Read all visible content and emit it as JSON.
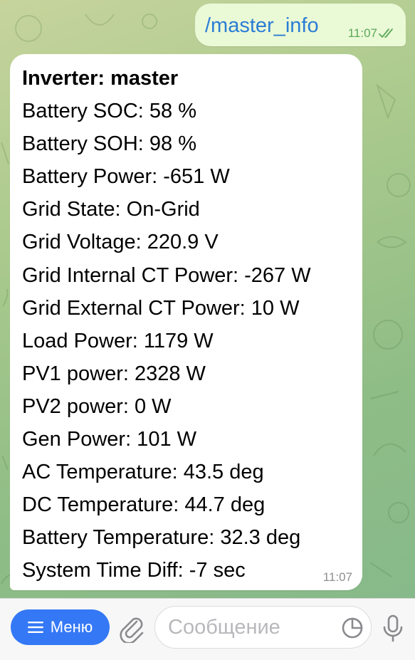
{
  "outgoing_message": {
    "text": "/master_info",
    "time": "11:07",
    "status_icon": "double-check-icon"
  },
  "incoming_message": {
    "lines": [
      "Inverter: master",
      "Battery SOC: 58 %",
      "Battery SOH: 98 %",
      "Battery Power: -651 W",
      "Grid State: On-Grid",
      "Grid Voltage: 220.9 V",
      "Grid Internal CT Power: -267 W",
      "Grid External CT Power: 10 W",
      "Load Power: 1179 W",
      "PV1 power: 2328 W",
      "PV2 power: 0 W",
      "Gen Power: 101 W",
      "AC Temperature: 43.5 deg",
      "DC Temperature: 44.7 deg",
      "Battery Temperature: 32.3 deg",
      "System Time Diff: -7 sec"
    ],
    "time": "11:07"
  },
  "input_bar": {
    "menu_label": "Меню",
    "menu_icon": "hamburger-icon",
    "attach_icon": "paperclip-icon",
    "placeholder": "Сообщение",
    "value": "",
    "sticker_icon": "sticker-icon",
    "mic_icon": "microphone-icon"
  },
  "colors": {
    "accent": "#3478f6",
    "outgoing_bubble": "#eaf9d6",
    "outgoing_text": "#2b7dd6",
    "read_check": "#5da85a",
    "incoming_bubble": "#ffffff"
  }
}
